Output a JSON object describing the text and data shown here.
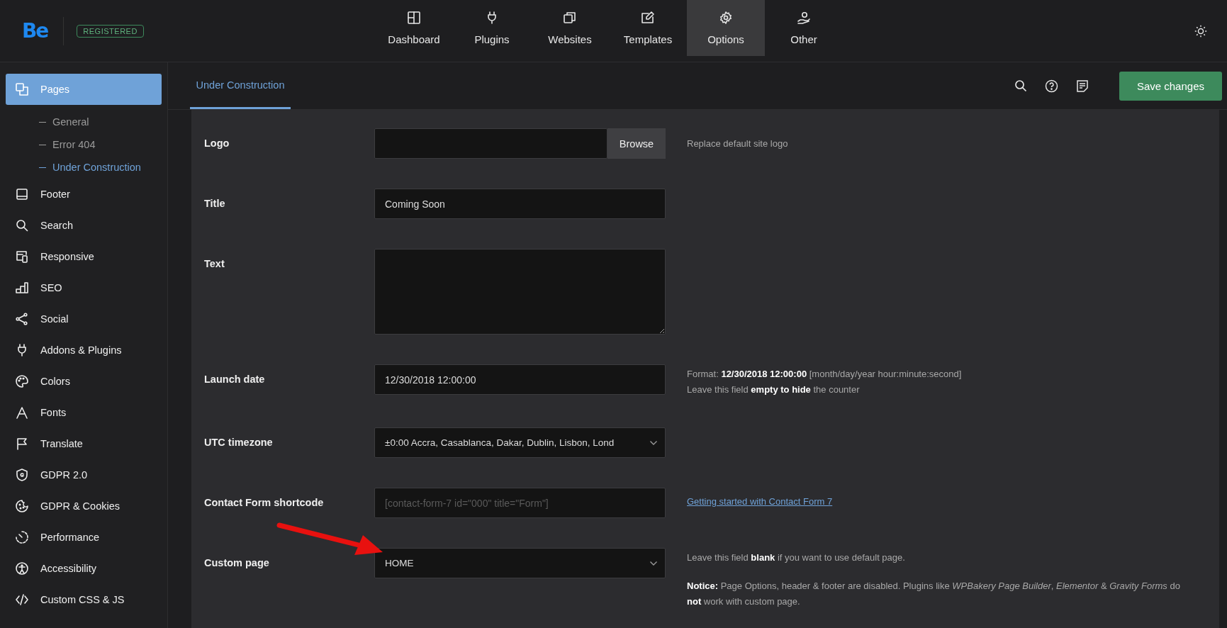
{
  "header": {
    "logo": "Be",
    "badge": "REGISTERED",
    "nav": [
      {
        "label": "Dashboard",
        "selected": false
      },
      {
        "label": "Plugins",
        "selected": false
      },
      {
        "label": "Websites",
        "selected": false
      },
      {
        "label": "Templates",
        "selected": false
      },
      {
        "label": "Options",
        "selected": true
      },
      {
        "label": "Other",
        "selected": false
      }
    ]
  },
  "sidebar": {
    "items": [
      {
        "label": "Pages",
        "selected": true,
        "children": [
          {
            "label": "General",
            "selected": false
          },
          {
            "label": "Error 404",
            "selected": false
          },
          {
            "label": "Under Construction",
            "selected": true
          }
        ]
      },
      {
        "label": "Footer",
        "selected": false
      },
      {
        "label": "Search",
        "selected": false
      },
      {
        "label": "Responsive",
        "selected": false
      },
      {
        "label": "SEO",
        "selected": false
      },
      {
        "label": "Social",
        "selected": false
      },
      {
        "label": "Addons & Plugins",
        "selected": false
      },
      {
        "label": "Colors",
        "selected": false
      },
      {
        "label": "Fonts",
        "selected": false
      },
      {
        "label": "Translate",
        "selected": false
      },
      {
        "label": "GDPR 2.0",
        "selected": false
      },
      {
        "label": "GDPR & Cookies",
        "selected": false
      },
      {
        "label": "Performance",
        "selected": false
      },
      {
        "label": "Accessibility",
        "selected": false
      },
      {
        "label": "Custom CSS & JS",
        "selected": false
      }
    ]
  },
  "content": {
    "tabs": [
      {
        "label": "Under Construction",
        "selected": true
      }
    ],
    "save_button": "Save changes",
    "rows": [
      {
        "label": "Logo",
        "kind": "file",
        "button": "Browse",
        "help": [
          {
            "kind": "text",
            "lines": [
              "Replace default site logo"
            ]
          }
        ]
      },
      {
        "label": "Title",
        "kind": "text",
        "value": "Coming Soon"
      },
      {
        "label": "Text",
        "kind": "textarea"
      },
      {
        "label": "Launch date",
        "kind": "text",
        "value": "12/30/2018 12:00:00",
        "help": [
          {
            "kind": "text",
            "lines": [
              "Format: **12/30/2018 12:00:00** [month/day/year hour:minute:second]",
              "Leave this field **empty to hide** the counter"
            ]
          }
        ]
      },
      {
        "label": "UTC timezone",
        "kind": "select",
        "value": "±0:00 Accra, Casablanca, Dakar, Dublin, Lisbon, Lond"
      },
      {
        "label": "Contact Form shortcode",
        "kind": "text",
        "placeholder": "[contact-form-7 id=\"000\" title=\"Form\"]",
        "help": [
          {
            "kind": "link",
            "lines": [
              "Getting started with Contact Form 7"
            ]
          }
        ]
      },
      {
        "label": "Custom page",
        "kind": "select",
        "value": "HOME",
        "pointed": true,
        "help": [
          {
            "kind": "text",
            "lines": [
              "Leave this field **blank** if you want to use default page."
            ]
          },
          {
            "kind": "text",
            "lines": [
              "**Notice:** Page Options, header & footer are disabled. Plugins like *WPBakery Page Builder*, *Elementor* & *Gravity Forms* do **not** work with custom page."
            ]
          }
        ]
      }
    ]
  }
}
